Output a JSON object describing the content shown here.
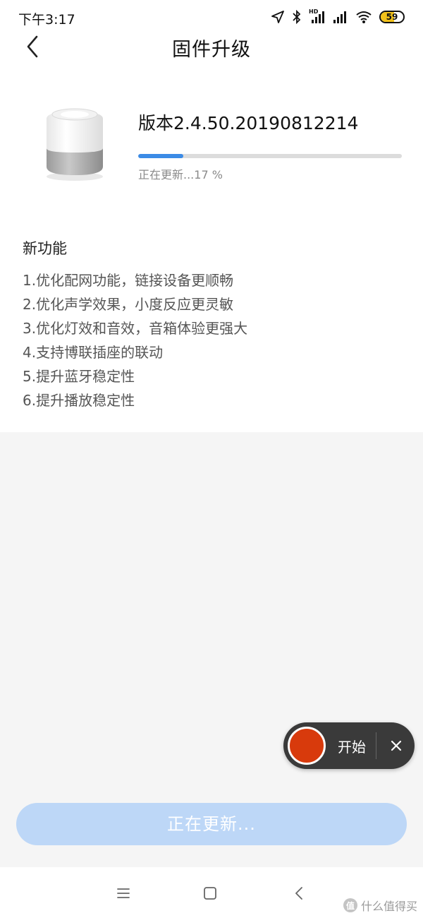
{
  "status_bar": {
    "time": "下午3:17",
    "network_badge": "HD",
    "battery_level": "59",
    "battery_fraction": 0.59,
    "icons": [
      "send-icon",
      "bluetooth-icon",
      "signal-hd-icon",
      "signal-icon",
      "wifi-icon",
      "battery-icon"
    ]
  },
  "header": {
    "title": "固件升级",
    "back_icon": "chevron-left-icon"
  },
  "device": {
    "image_icon": "smart-speaker-icon",
    "version": "版本2.4.50.20190812214",
    "progress_percent": 17,
    "progress_status": "正在更新...17 %"
  },
  "features": {
    "heading": "新功能",
    "items": [
      "1.优化配网功能，链接设备更顺畅",
      "2.优化声学效果，小度反应更灵敏",
      "3.优化灯效和音效，音箱体验更强大",
      "4.支持博联插座的联动",
      "5.提升蓝牙稳定性",
      "6.提升播放稳定性"
    ]
  },
  "recorder": {
    "start_label": "开始",
    "record_color": "#d83a0c"
  },
  "update_button": {
    "label": "正在更新..."
  },
  "nav_bar": {
    "icons": [
      "menu-icon",
      "home-icon",
      "back-icon"
    ]
  },
  "watermark": {
    "badge": "值",
    "text": "什么值得买"
  },
  "colors": {
    "accent": "#3b8be6",
    "button_disabled": "#bdd7f7",
    "background": "#f5f5f5"
  }
}
